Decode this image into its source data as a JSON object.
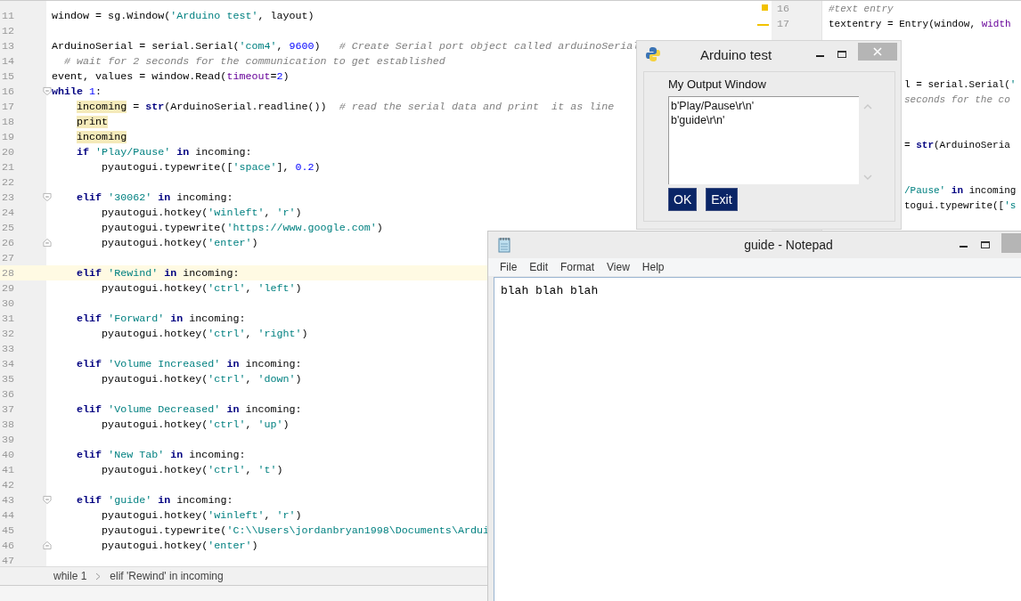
{
  "editor": {
    "lines": [
      {
        "number": "11",
        "kind": "plain",
        "current": false,
        "code": [
          {
            "kind": "plain",
            "text": "window = sg.Window("
          },
          {
            "kind": "str",
            "text": "'Arduino test'"
          },
          {
            "kind": "plain",
            "text": ", layout)"
          }
        ]
      },
      {
        "number": "12",
        "kind": "plain",
        "current": false
      },
      {
        "number": "13",
        "kind": "plain",
        "current": false,
        "code": [
          {
            "kind": "plain",
            "text": "ArduinoSerial = serial.Serial("
          },
          {
            "kind": "str",
            "text": "'com4'"
          },
          {
            "kind": "plain",
            "text": ", "
          },
          {
            "kind": "num",
            "text": "9600"
          },
          {
            "kind": "plain",
            "text": ")   "
          },
          {
            "kind": "cmt",
            "text": "# Create Serial port object called arduinoSerial"
          }
        ]
      },
      {
        "number": "14",
        "kind": "plain",
        "current": false,
        "code": [
          {
            "kind": "cmt",
            "text": "  # wait for 2 seconds for the communication to get established"
          }
        ]
      },
      {
        "number": "15",
        "kind": "plain",
        "current": false,
        "code": [
          {
            "kind": "plain",
            "text": "event, values = window.Read("
          },
          {
            "kind": "param",
            "text": "timeout"
          },
          {
            "kind": "plain",
            "text": "="
          },
          {
            "kind": "num",
            "text": "2"
          },
          {
            "kind": "plain",
            "text": ")"
          }
        ]
      },
      {
        "number": "16",
        "kind": "fold-start",
        "current": false,
        "code": [
          {
            "kind": "kw",
            "text": "while "
          },
          {
            "kind": "num",
            "text": "1"
          },
          {
            "kind": "plain",
            "text": ":"
          }
        ]
      },
      {
        "number": "17",
        "kind": "plain",
        "current": false,
        "code": [
          {
            "kind": "mark",
            "text": "    incoming"
          },
          {
            "kind": "plain",
            "text": " = "
          },
          {
            "kind": "kw",
            "text": "str"
          },
          {
            "kind": "plain",
            "text": "(ArduinoSerial.readline())  "
          },
          {
            "kind": "cmt",
            "text": "# read the serial data and print  it as line"
          }
        ]
      },
      {
        "number": "18",
        "kind": "plain",
        "current": false,
        "code": [
          {
            "kind": "mark",
            "text": "    print"
          }
        ]
      },
      {
        "number": "19",
        "kind": "plain",
        "current": false,
        "code": [
          {
            "kind": "mark",
            "text": "    incoming"
          }
        ]
      },
      {
        "number": "20",
        "kind": "plain",
        "current": false,
        "code": [
          {
            "kind": "kw",
            "text": "    if "
          },
          {
            "kind": "str",
            "text": "'Play/Pause'"
          },
          {
            "kind": "kw",
            "text": " in "
          },
          {
            "kind": "plain",
            "text": "incoming:"
          }
        ]
      },
      {
        "number": "21",
        "kind": "plain",
        "current": false,
        "code": [
          {
            "kind": "plain",
            "text": "        pyautogui.typewrite(["
          },
          {
            "kind": "str",
            "text": "'space'"
          },
          {
            "kind": "plain",
            "text": "], "
          },
          {
            "kind": "num",
            "text": "0.2"
          },
          {
            "kind": "plain",
            "text": ")"
          }
        ]
      },
      {
        "number": "22",
        "kind": "plain",
        "current": false
      },
      {
        "number": "23",
        "kind": "fold-start",
        "current": false,
        "code": [
          {
            "kind": "kw",
            "text": "    elif "
          },
          {
            "kind": "str",
            "text": "'30062'"
          },
          {
            "kind": "kw",
            "text": " in "
          },
          {
            "kind": "plain",
            "text": "incoming:"
          }
        ]
      },
      {
        "number": "24",
        "kind": "plain",
        "current": false,
        "code": [
          {
            "kind": "plain",
            "text": "        pyautogui.hotkey("
          },
          {
            "kind": "str",
            "text": "'winleft'"
          },
          {
            "kind": "plain",
            "text": ", "
          },
          {
            "kind": "str",
            "text": "'r'"
          },
          {
            "kind": "plain",
            "text": ")"
          }
        ]
      },
      {
        "number": "25",
        "kind": "plain",
        "current": false,
        "code": [
          {
            "kind": "plain",
            "text": "        pyautogui.typewrite("
          },
          {
            "kind": "str",
            "text": "'https://www.google.com'"
          },
          {
            "kind": "plain",
            "text": ")"
          }
        ]
      },
      {
        "number": "26",
        "kind": "fold-end",
        "current": false,
        "code": [
          {
            "kind": "plain",
            "text": "        pyautogui.hotkey("
          },
          {
            "kind": "str",
            "text": "'enter'"
          },
          {
            "kind": "plain",
            "text": ")"
          }
        ]
      },
      {
        "number": "27",
        "kind": "plain",
        "current": false
      },
      {
        "number": "28",
        "kind": "plain",
        "current": true,
        "code": [
          {
            "kind": "kw",
            "text": "    elif "
          },
          {
            "kind": "str",
            "text": "'Rewind'"
          },
          {
            "kind": "kw",
            "text": " in "
          },
          {
            "kind": "plain",
            "text": "incoming:"
          }
        ]
      },
      {
        "number": "29",
        "kind": "plain",
        "current": false,
        "code": [
          {
            "kind": "plain",
            "text": "        pyautogui.hotkey("
          },
          {
            "kind": "str",
            "text": "'ctrl'"
          },
          {
            "kind": "plain",
            "text": ", "
          },
          {
            "kind": "str",
            "text": "'left'"
          },
          {
            "kind": "plain",
            "text": ")"
          }
        ]
      },
      {
        "number": "30",
        "kind": "plain",
        "current": false
      },
      {
        "number": "31",
        "kind": "plain",
        "current": false,
        "code": [
          {
            "kind": "kw",
            "text": "    elif "
          },
          {
            "kind": "str",
            "text": "'Forward'"
          },
          {
            "kind": "kw",
            "text": " in "
          },
          {
            "kind": "plain",
            "text": "incoming:"
          }
        ]
      },
      {
        "number": "32",
        "kind": "plain",
        "current": false,
        "code": [
          {
            "kind": "plain",
            "text": "        pyautogui.hotkey("
          },
          {
            "kind": "str",
            "text": "'ctrl'"
          },
          {
            "kind": "plain",
            "text": ", "
          },
          {
            "kind": "str",
            "text": "'right'"
          },
          {
            "kind": "plain",
            "text": ")"
          }
        ]
      },
      {
        "number": "33",
        "kind": "plain",
        "current": false
      },
      {
        "number": "34",
        "kind": "plain",
        "current": false,
        "code": [
          {
            "kind": "kw",
            "text": "    elif "
          },
          {
            "kind": "str",
            "text": "'Volume Increased'"
          },
          {
            "kind": "kw",
            "text": " in "
          },
          {
            "kind": "plain",
            "text": "incoming:"
          }
        ]
      },
      {
        "number": "35",
        "kind": "plain",
        "current": false,
        "code": [
          {
            "kind": "plain",
            "text": "        pyautogui.hotkey("
          },
          {
            "kind": "str",
            "text": "'ctrl'"
          },
          {
            "kind": "plain",
            "text": ", "
          },
          {
            "kind": "str",
            "text": "'down'"
          },
          {
            "kind": "plain",
            "text": ")"
          }
        ]
      },
      {
        "number": "36",
        "kind": "plain",
        "current": false
      },
      {
        "number": "37",
        "kind": "plain",
        "current": false,
        "code": [
          {
            "kind": "kw",
            "text": "    elif "
          },
          {
            "kind": "str",
            "text": "'Volume Decreased'"
          },
          {
            "kind": "kw",
            "text": " in "
          },
          {
            "kind": "plain",
            "text": "incoming:"
          }
        ]
      },
      {
        "number": "38",
        "kind": "plain",
        "current": false,
        "code": [
          {
            "kind": "plain",
            "text": "        pyautogui.hotkey("
          },
          {
            "kind": "str",
            "text": "'ctrl'"
          },
          {
            "kind": "plain",
            "text": ", "
          },
          {
            "kind": "str",
            "text": "'up'"
          },
          {
            "kind": "plain",
            "text": ")"
          }
        ]
      },
      {
        "number": "39",
        "kind": "plain",
        "current": false
      },
      {
        "number": "40",
        "kind": "plain",
        "current": false,
        "code": [
          {
            "kind": "kw",
            "text": "    elif "
          },
          {
            "kind": "str",
            "text": "'New Tab'"
          },
          {
            "kind": "kw",
            "text": " in "
          },
          {
            "kind": "plain",
            "text": "incoming:"
          }
        ]
      },
      {
        "number": "41",
        "kind": "plain",
        "current": false,
        "code": [
          {
            "kind": "plain",
            "text": "        pyautogui.hotkey("
          },
          {
            "kind": "str",
            "text": "'ctrl'"
          },
          {
            "kind": "plain",
            "text": ", "
          },
          {
            "kind": "str",
            "text": "'t'"
          },
          {
            "kind": "plain",
            "text": ")"
          }
        ]
      },
      {
        "number": "42",
        "kind": "plain",
        "current": false
      },
      {
        "number": "43",
        "kind": "fold-start",
        "current": false,
        "code": [
          {
            "kind": "kw",
            "text": "    elif "
          },
          {
            "kind": "str",
            "text": "'guide'"
          },
          {
            "kind": "kw",
            "text": " in "
          },
          {
            "kind": "plain",
            "text": "incoming:"
          }
        ]
      },
      {
        "number": "44",
        "kind": "plain",
        "current": false,
        "code": [
          {
            "kind": "plain",
            "text": "        pyautogui.hotkey("
          },
          {
            "kind": "str",
            "text": "'winleft'"
          },
          {
            "kind": "plain",
            "text": ", "
          },
          {
            "kind": "str",
            "text": "'r'"
          },
          {
            "kind": "plain",
            "text": ")"
          }
        ]
      },
      {
        "number": "45",
        "kind": "plain",
        "current": false,
        "code": [
          {
            "kind": "plain",
            "text": "        pyautogui.typewrite("
          },
          {
            "kind": "str",
            "text": "'C:\\\\Users\\jordanbryan1998\\Documents\\Ardui"
          }
        ]
      },
      {
        "number": "46",
        "kind": "fold-end",
        "current": false,
        "code": [
          {
            "kind": "plain",
            "text": "        pyautogui.hotkey("
          },
          {
            "kind": "str",
            "text": "'enter'"
          },
          {
            "kind": "plain",
            "text": ")"
          }
        ]
      },
      {
        "number": "47",
        "kind": "plain",
        "current": false
      }
    ],
    "breadcrumbs": [
      "while 1",
      "elif 'Rewind' in incoming"
    ]
  },
  "right_pane": {
    "lines": [
      {
        "kind": "full",
        "number": "16",
        "code": [
          {
            "kind": "cmt",
            "text": "#text entry"
          }
        ]
      },
      {
        "kind": "full",
        "number": "17",
        "code": [
          {
            "kind": "plain",
            "text": "textentry = Entry(window, "
          },
          {
            "kind": "param",
            "text": "width"
          }
        ]
      },
      {
        "kind": "hidden"
      },
      {
        "kind": "hidden"
      },
      {
        "kind": "hidden"
      },
      {
        "kind": "tail",
        "code": [
          {
            "kind": "plain",
            "text": "l = serial.Serial("
          },
          {
            "kind": "str",
            "text": "'"
          }
        ]
      },
      {
        "kind": "tail",
        "code": [
          {
            "kind": "cmt",
            "text": "seconds for the co"
          }
        ]
      },
      {
        "kind": "hidden"
      },
      {
        "kind": "hidden"
      },
      {
        "kind": "tail",
        "code": [
          {
            "kind": "plain",
            "text": "= "
          },
          {
            "kind": "kw",
            "text": "str"
          },
          {
            "kind": "plain",
            "text": "(ArduinoSeria"
          }
        ]
      },
      {
        "kind": "hidden"
      },
      {
        "kind": "hidden"
      },
      {
        "kind": "tail",
        "code": [
          {
            "kind": "str",
            "text": "/Pause'"
          },
          {
            "kind": "kw",
            "text": " in "
          },
          {
            "kind": "plain",
            "text": "incoming"
          }
        ]
      },
      {
        "kind": "tail",
        "code": [
          {
            "kind": "plain",
            "text": "togui.typewrite(["
          },
          {
            "kind": "str",
            "text": "'s"
          }
        ]
      }
    ]
  },
  "dialog": {
    "title": "Arduino test",
    "label": "My Output Window",
    "output": [
      "b'Play/Pause\\r\\n'",
      "b'guide\\r\\n'"
    ],
    "buttons": [
      "OK",
      "Exit"
    ]
  },
  "notepad": {
    "title": "guide - Notepad",
    "menu": [
      "File",
      "Edit",
      "Format",
      "View",
      "Help"
    ],
    "text": "blah blah blah"
  }
}
